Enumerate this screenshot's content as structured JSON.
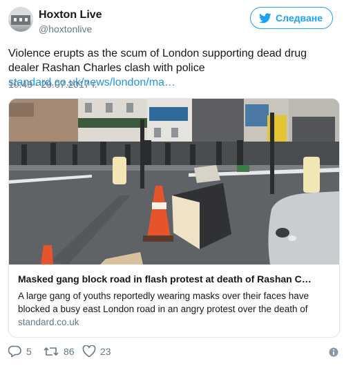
{
  "author": {
    "name": "Hoxton Live",
    "handle": "@hoxtonlive"
  },
  "follow_button": {
    "label": "Следване",
    "icon": "twitter-bird-icon"
  },
  "tweet": {
    "text": "Violence erupts as the scum of London supporting dead drug dealer Rashan Charles clash with police ",
    "link": "standard.co.uk/news/london/ma…",
    "timestamp": "10:49 - 29.07.2017 г."
  },
  "card": {
    "title": "Masked gang block road in flash protest at death of Rashan C…",
    "description": "A large gang of youths reportedly wearing masks over their faces have blocked a busy east London road in an angry protest over the death of",
    "domain": "standard.co.uk"
  },
  "actions": {
    "replies": "5",
    "retweets": "86",
    "likes": "23"
  },
  "colors": {
    "accent": "#1da1f2",
    "link": "#1b95e0",
    "muted": "#657786",
    "text": "#14171a",
    "border": "#e1e8ed"
  },
  "icons": [
    "reply-icon",
    "retweet-icon",
    "like-icon",
    "info-icon",
    "twitter-bird-icon"
  ]
}
